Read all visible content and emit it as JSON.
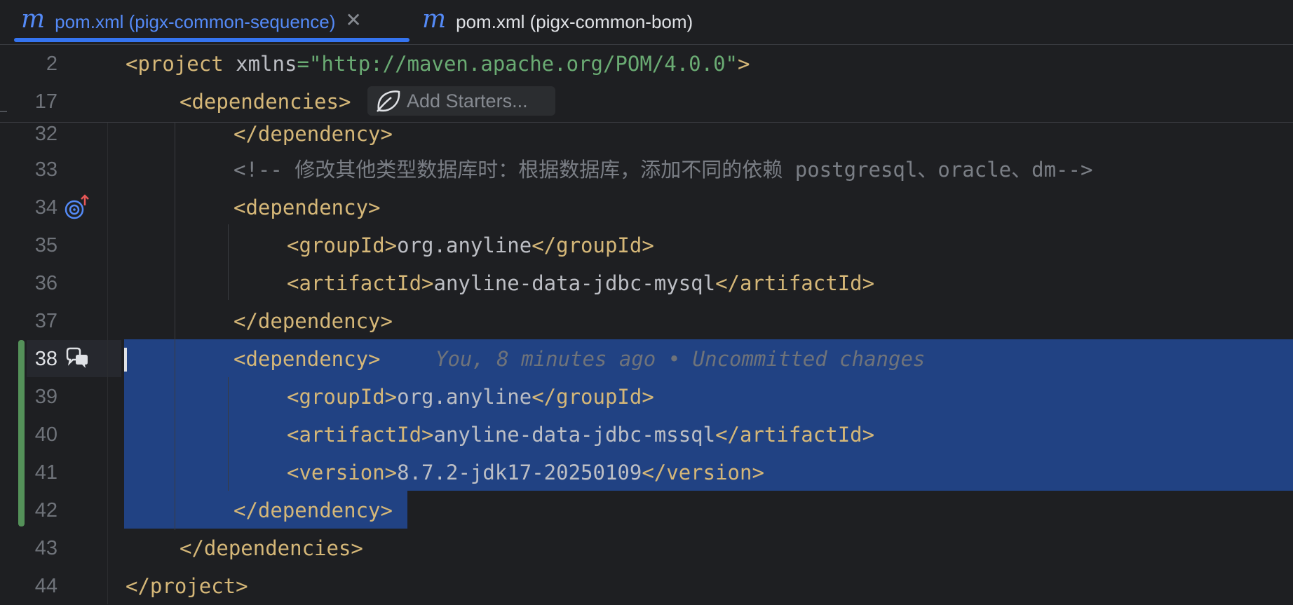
{
  "tabs": [
    {
      "icon": "maven-file-icon",
      "label": "pom.xml (pigx-common-sequence)",
      "active": true,
      "close": "✕"
    },
    {
      "icon": "maven-file-icon",
      "label": "pom.xml (pigx-common-bom)",
      "active": false
    }
  ],
  "tab_icon_glyph": "m",
  "sticky": [
    {
      "num": "2",
      "tag_open": "<project ",
      "attr": "xmlns",
      "eq": "=",
      "value": "\"http://maven.apache.org/POM/4.0.0\""
    },
    {
      "num": "17",
      "tag": "<dependencies>",
      "hint_button": "Add Starters..."
    }
  ],
  "lines": [
    {
      "num": "32",
      "text": "</dependency>"
    },
    {
      "num": "33",
      "comment": "<!-- 修改其他类型数据库时：根据数据库，添加不同的依赖 postgresql、oracle、dm-->"
    },
    {
      "num": "34",
      "text": "<dependency>",
      "gutter_icon": "dependency-update-icon"
    },
    {
      "num": "35",
      "open": "<groupId>",
      "value": "org.anyline",
      "close": "</groupId>"
    },
    {
      "num": "36",
      "open": "<artifactId>",
      "value": "anyline-data-jdbc-mysql",
      "close": "</artifactId>"
    },
    {
      "num": "37",
      "text": "</dependency>"
    },
    {
      "num": "38",
      "text": "<dependency>",
      "blame": "You, 8 minutes ago • Uncommitted changes",
      "gutter_icon": "ai-assistant-icon"
    },
    {
      "num": "39",
      "open": "<groupId>",
      "value": "org.anyline",
      "close": "</groupId>"
    },
    {
      "num": "40",
      "open": "<artifactId>",
      "value": "anyline-data-jdbc-mssql",
      "close": "</artifactId>"
    },
    {
      "num": "41",
      "open": "<version>",
      "value": "8.7.2-jdk17-20250109",
      "close": "</version>"
    },
    {
      "num": "42",
      "text": "</dependency>"
    },
    {
      "num": "43",
      "text": "</dependencies>"
    },
    {
      "num": "44",
      "text": "</project>"
    }
  ],
  "colors": {
    "background": "#1e1f22",
    "tag": "#d5b778",
    "string": "#6aab73",
    "comment": "#7a7e85",
    "selection": "#214283",
    "accent": "#3574f0",
    "vcs_added": "#549159"
  }
}
